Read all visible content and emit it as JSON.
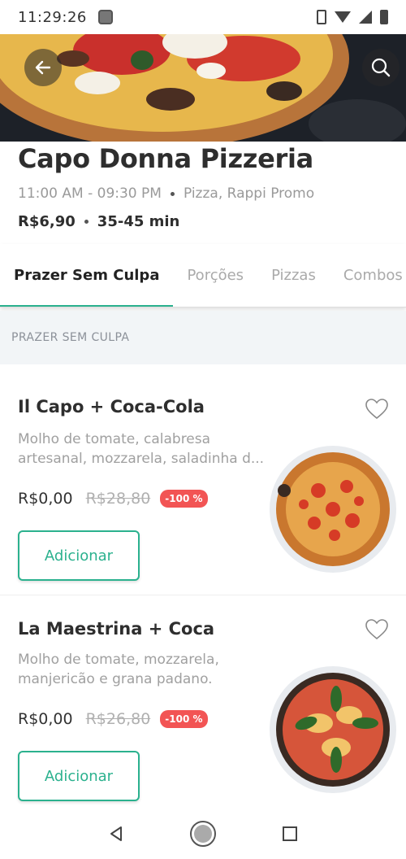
{
  "status_bar": {
    "time": "11:29:26"
  },
  "restaurant": {
    "name": "Capo Donna Pizzeria",
    "hours": "11:00 AM - 09:30 PM",
    "categories": "Pizza, Rappi Promo",
    "delivery_fee": "R$6,90",
    "delivery_time": "35-45 min"
  },
  "tabs": [
    {
      "label": "Prazer Sem Culpa",
      "active": true
    },
    {
      "label": "Porções",
      "active": false
    },
    {
      "label": "Pizzas",
      "active": false
    },
    {
      "label": "Combos",
      "active": false
    }
  ],
  "section": {
    "title": "PRAZER SEM CULPA"
  },
  "products": [
    {
      "title": "Il Capo + Coca-Cola",
      "description": "Molho de tomate, calabresa artesanal, mozzarela, saladinha d...",
      "price": "R$0,00",
      "old_price": "R$28,80",
      "discount": "-100 %",
      "add_label": "Adicionar"
    },
    {
      "title": "La Maestrina + Coca",
      "description": "Molho de tomate, mozzarela, manjericão e grana padano.",
      "price": "R$0,00",
      "old_price": "R$26,80",
      "discount": "-100 %",
      "add_label": "Adicionar"
    }
  ],
  "colors": {
    "accent": "#2bb18e",
    "badge": "#f25454"
  }
}
